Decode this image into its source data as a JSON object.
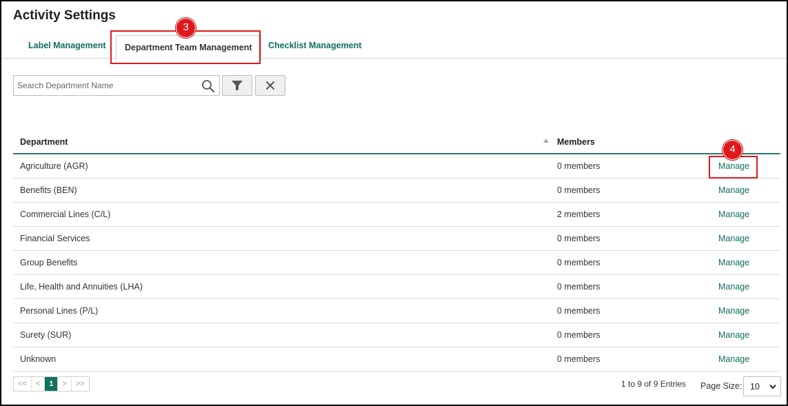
{
  "page": {
    "title": "Activity Settings"
  },
  "tabs": [
    {
      "label": "Label Management"
    },
    {
      "label": "Department Team Management"
    },
    {
      "label": "Checklist Management"
    }
  ],
  "callouts": {
    "step3": "3",
    "step4": "4"
  },
  "search": {
    "placeholder": "Search Department Name",
    "value": ""
  },
  "table": {
    "headers": {
      "department": "Department",
      "members": "Members"
    },
    "rows": [
      {
        "department": "Agriculture (AGR)",
        "members": "0 members",
        "action": "Manage"
      },
      {
        "department": "Benefits (BEN)",
        "members": "0 members",
        "action": "Manage"
      },
      {
        "department": "Commercial Lines (C/L)",
        "members": "2 members",
        "action": "Manage"
      },
      {
        "department": "Financial Services",
        "members": "0 members",
        "action": "Manage"
      },
      {
        "department": "Group Benefits",
        "members": "0 members",
        "action": "Manage"
      },
      {
        "department": "Life, Health and Annuities (LHA)",
        "members": "0 members",
        "action": "Manage"
      },
      {
        "department": "Personal Lines (P/L)",
        "members": "0 members",
        "action": "Manage"
      },
      {
        "department": "Surety (SUR)",
        "members": "0 members",
        "action": "Manage"
      },
      {
        "department": "Unknown",
        "members": "0 members",
        "action": "Manage"
      }
    ]
  },
  "pagination": {
    "first": "<<",
    "prev": "<",
    "current": "1",
    "next": ">",
    "last": ">>",
    "entries": "1 to 9 of 9 Entries",
    "page_size_label": "Page Size:",
    "page_size_value": "10"
  },
  "colors": {
    "accent": "#0e6e5e",
    "callout": "#e0181b",
    "active_page": "#11725f"
  },
  "icons": [
    "search-icon",
    "filter-icon",
    "close-icon",
    "sort-up-icon",
    "chevron-down-icon"
  ]
}
